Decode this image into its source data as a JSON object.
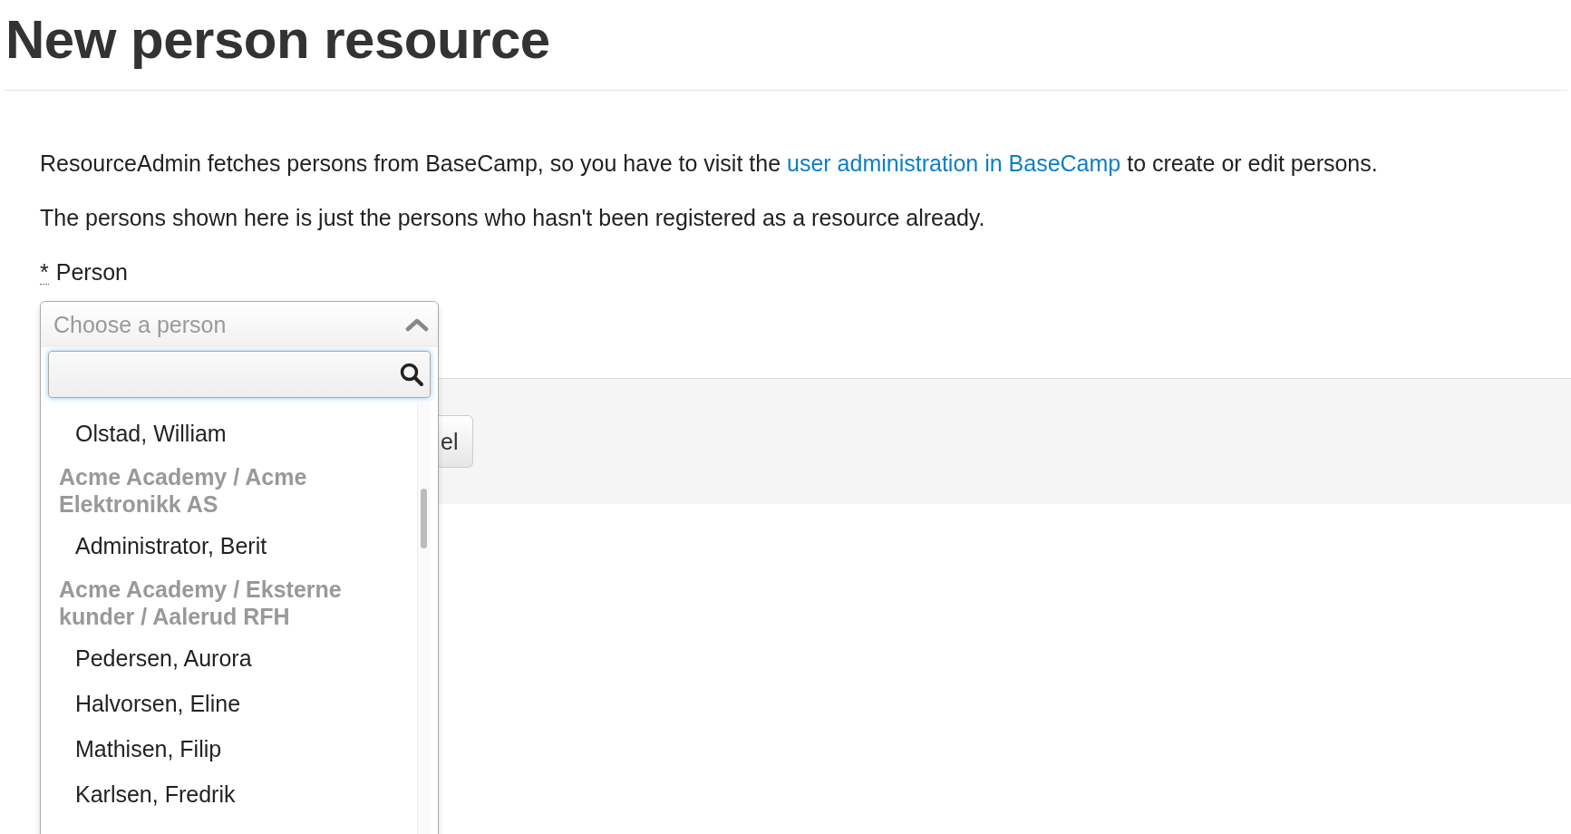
{
  "page": {
    "title": "New person resource"
  },
  "intro": {
    "before": "ResourceAdmin fetches persons from BaseCamp, so you have to visit the ",
    "link": "user administration in BaseCamp",
    "after": " to create or edit persons."
  },
  "note": "The persons shown here is just the persons who hasn't been registered as a resource already.",
  "field": {
    "required_mark": "*",
    "label": "Person",
    "placeholder": "Choose a person",
    "expanded": true
  },
  "options": [
    {
      "kind": "option",
      "label": "Olstad, William"
    },
    {
      "kind": "group",
      "label": "Acme Academy / Acme Elektronikk AS"
    },
    {
      "kind": "option",
      "label": "Administrator, Berit"
    },
    {
      "kind": "group",
      "label": "Acme Academy / Eksterne kunder / Aalerud RFH"
    },
    {
      "kind": "option",
      "label": "Pedersen, Aurora"
    },
    {
      "kind": "option",
      "label": "Halvorsen, Eline"
    },
    {
      "kind": "option",
      "label": "Mathisen, Filip"
    },
    {
      "kind": "option",
      "label": "Karlsen, Fredrik"
    }
  ],
  "buttons": [
    "el"
  ]
}
